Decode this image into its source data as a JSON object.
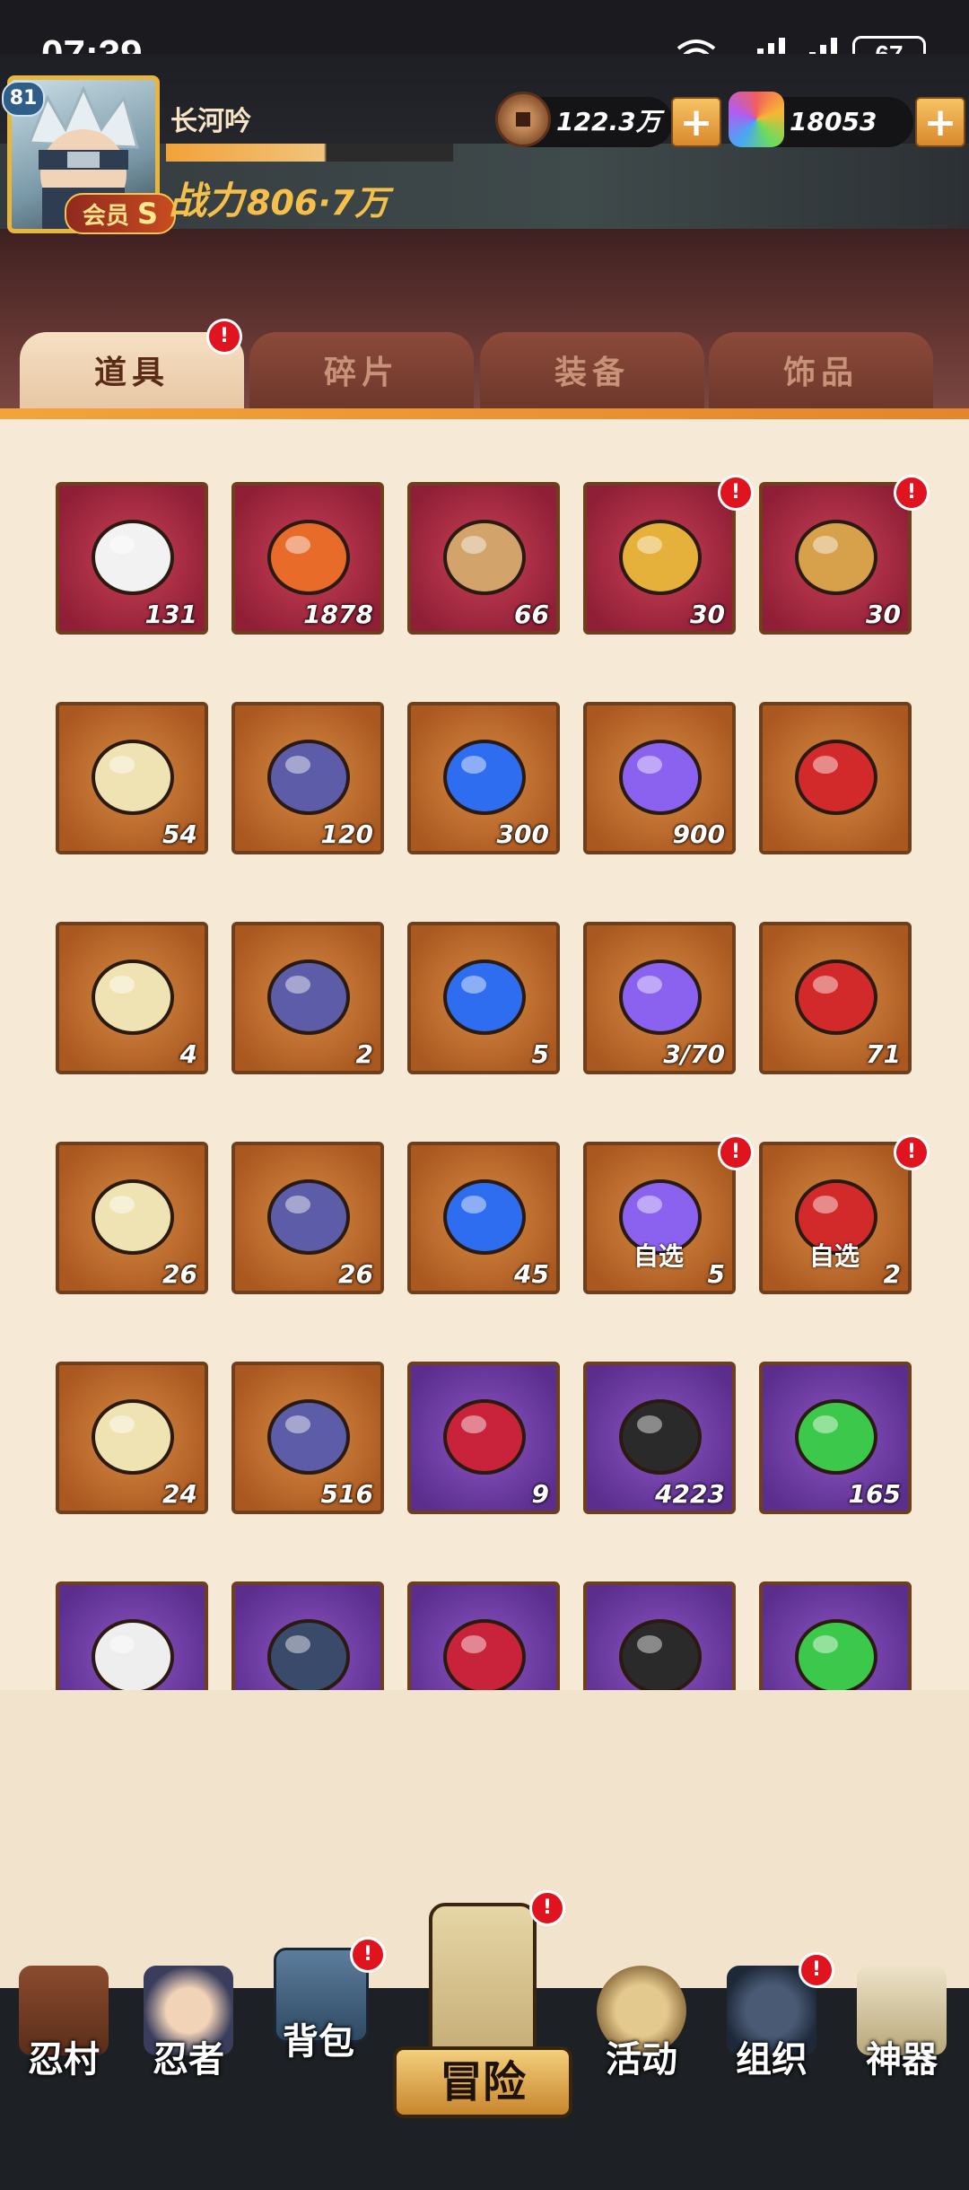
{
  "status_bar": {
    "time": "07:39",
    "battery": "67"
  },
  "player": {
    "level": "81",
    "name": "长河吟",
    "member_label": "会员",
    "member_rank": "S",
    "power_label": "战力",
    "power_value": "806·7万"
  },
  "currencies": {
    "copper": {
      "icon": "copper-coin-icon",
      "value": "122.3万",
      "plus": "+"
    },
    "gem": {
      "icon": "rainbow-gem-icon",
      "value": "18053",
      "plus": "+"
    }
  },
  "tabs": [
    {
      "label": "道具",
      "active": true,
      "badge": "!"
    },
    {
      "label": "碎片",
      "active": false
    },
    {
      "label": "装备",
      "active": false
    },
    {
      "label": "饰品",
      "active": false
    }
  ],
  "items": [
    {
      "icon": "scroll-bundle-icon",
      "quality": "red",
      "count": "131"
    },
    {
      "icon": "flame-feather-icon",
      "quality": "red",
      "count": "1878"
    },
    {
      "icon": "wooden-stick-icon",
      "quality": "red",
      "count": "66"
    },
    {
      "icon": "gift-box-icon",
      "quality": "red",
      "count": "30",
      "badge": "!"
    },
    {
      "icon": "treasure-chest-icon",
      "quality": "red",
      "count": "30",
      "badge": "!"
    },
    {
      "icon": "ninja-scroll-icon",
      "quality": "orange",
      "count": "54"
    },
    {
      "icon": "seal-banner-icon",
      "quality": "orange",
      "count": "120"
    },
    {
      "icon": "blue-orb-icon",
      "quality": "orange",
      "count": "300"
    },
    {
      "icon": "purple-orb-icon",
      "quality": "orange",
      "count": "900"
    },
    {
      "icon": "red-emblem-icon",
      "quality": "orange",
      "count": ""
    },
    {
      "icon": "target-emblem-icon",
      "quality": "orange",
      "count": "4"
    },
    {
      "icon": "eye-emblem-icon",
      "quality": "orange",
      "count": "2"
    },
    {
      "icon": "blue-moon-icon",
      "quality": "orange",
      "count": "5"
    },
    {
      "icon": "purple-crystal-icon",
      "quality": "orange",
      "count": "3/70"
    },
    {
      "icon": "fortune-banner-icon",
      "quality": "orange",
      "count": "71"
    },
    {
      "icon": "bronze-key-icon",
      "quality": "orange",
      "count": "26"
    },
    {
      "icon": "paper-talisman-icon",
      "quality": "orange",
      "count": "26"
    },
    {
      "icon": "amber-gem-icon",
      "quality": "orange",
      "count": "45"
    },
    {
      "icon": "choice-box-icon",
      "quality": "orange",
      "count": "5",
      "tag": "自选",
      "badge": "!"
    },
    {
      "icon": "golden-choice-box-icon",
      "quality": "orange",
      "count": "2",
      "tag": "自选",
      "badge": "!"
    },
    {
      "icon": "point-card-icon",
      "quality": "orange",
      "count": "24"
    },
    {
      "icon": "voucher-icon",
      "quality": "orange",
      "count": "516"
    },
    {
      "icon": "white-scroll-icon",
      "quality": "purple",
      "count": "9"
    },
    {
      "icon": "upgrade-book-icon",
      "quality": "purple",
      "count": "4223"
    },
    {
      "icon": "red-potion-jar-icon",
      "quality": "purple",
      "count": "165"
    },
    {
      "icon": "black-ore-icon",
      "quality": "purple",
      "count": ""
    },
    {
      "icon": "yin-yang-icon",
      "quality": "purple",
      "count": ""
    },
    {
      "icon": "paper-stack-icon",
      "quality": "purple",
      "count": ""
    },
    {
      "icon": "red-case-icon",
      "quality": "purple",
      "count": ""
    },
    {
      "icon": "green-orb-icon",
      "quality": "purple",
      "count": ""
    }
  ],
  "nav": [
    {
      "label": "忍村",
      "icon": "village-gate-icon"
    },
    {
      "label": "忍者",
      "icon": "ninja-face-icon"
    },
    {
      "label": "背包",
      "icon": "backpack-icon",
      "badge": "!"
    },
    {
      "label": "冒险",
      "icon": "adventure-scroll-icon",
      "badge": "!"
    },
    {
      "label": "活动",
      "icon": "drum-icon"
    },
    {
      "label": "组织",
      "icon": "team-icon",
      "badge": "!"
    },
    {
      "label": "神器",
      "icon": "divine-book-icon"
    }
  ],
  "colors": {
    "accent": "#e3862d",
    "badge": "#e0141f",
    "gold": "#f4c04b"
  }
}
